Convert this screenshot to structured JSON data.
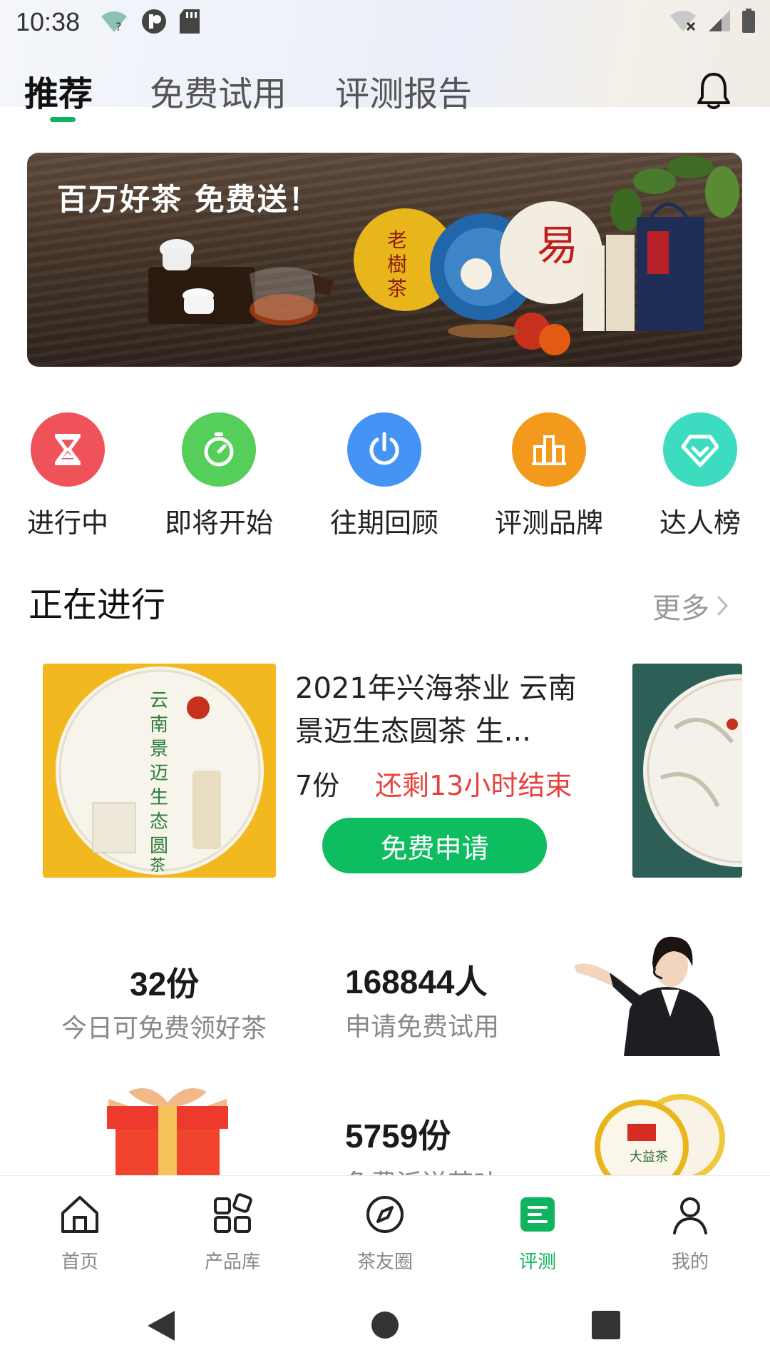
{
  "status_bar": {
    "time": "10:38"
  },
  "tabs": [
    {
      "label": "推荐",
      "active": true
    },
    {
      "label": "免费试用",
      "active": false
    },
    {
      "label": "评测报告",
      "active": false
    }
  ],
  "banner": {
    "title": "百万好茶 免费送！"
  },
  "quick_entries": [
    {
      "label": "进行中",
      "color": "#ef5258",
      "icon": "hourglass-icon"
    },
    {
      "label": "即将开始",
      "color": "#55cf5a",
      "icon": "timer-icon"
    },
    {
      "label": "往期回顾",
      "color": "#4593f5",
      "icon": "power-icon"
    },
    {
      "label": "评测品牌",
      "color": "#f39a1c",
      "icon": "brand-buildings-icon"
    },
    {
      "label": "达人榜",
      "color": "#3ddcc0",
      "icon": "diamond-icon"
    }
  ],
  "section": {
    "title": "正在进行",
    "more": "更多"
  },
  "ongoing": {
    "title": "2021年兴海茶业 云南景迈生态圆茶 生...",
    "count": "7份",
    "remaining": "还剩13小时结束",
    "apply_label": "免费申请"
  },
  "stats": [
    {
      "value": "32份",
      "label": "今日可免费领好茶"
    },
    {
      "value": "168844人",
      "label": "申请免费试用"
    },
    {
      "value": "5759份",
      "label": "免费派送茶叶"
    }
  ],
  "bottom_nav": [
    {
      "label": "首页",
      "icon": "home-icon",
      "active": false
    },
    {
      "label": "产品库",
      "icon": "grid-icon",
      "active": false
    },
    {
      "label": "茶友圈",
      "icon": "compass-icon",
      "active": false
    },
    {
      "label": "评测",
      "icon": "review-icon",
      "active": true
    },
    {
      "label": "我的",
      "icon": "user-icon",
      "active": false
    }
  ],
  "colors": {
    "accent": "#10b35e",
    "danger": "#e8423f"
  }
}
